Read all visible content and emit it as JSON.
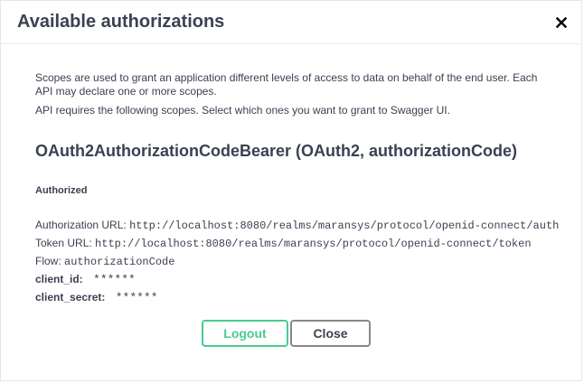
{
  "modal": {
    "title": "Available authorizations",
    "close_icon": "close-icon"
  },
  "description": {
    "line1": "Scopes are used to grant an application different levels of access to data on behalf of the end user. Each API may declare one or more scopes.",
    "line2": "API requires the following scopes. Select which ones you want to grant to Swagger UI."
  },
  "scheme": {
    "title": "OAuth2AuthorizationCodeBearer (OAuth2, authorizationCode)",
    "status": "Authorized",
    "authorization_url_label": "Authorization URL:",
    "authorization_url": "http://localhost:8080/realms/maransys/protocol/openid-connect/auth",
    "token_url_label": "Token URL:",
    "token_url": "http://localhost:8080/realms/maransys/protocol/openid-connect/token",
    "flow_label": "Flow:",
    "flow": "authorizationCode",
    "client_id_label": "client_id:",
    "client_id": "******",
    "client_secret_label": "client_secret:",
    "client_secret": "******"
  },
  "buttons": {
    "logout": "Logout",
    "close": "Close"
  },
  "colors": {
    "text": "#3b4151",
    "logout_border": "#49cc90",
    "close_border": "#888888"
  }
}
